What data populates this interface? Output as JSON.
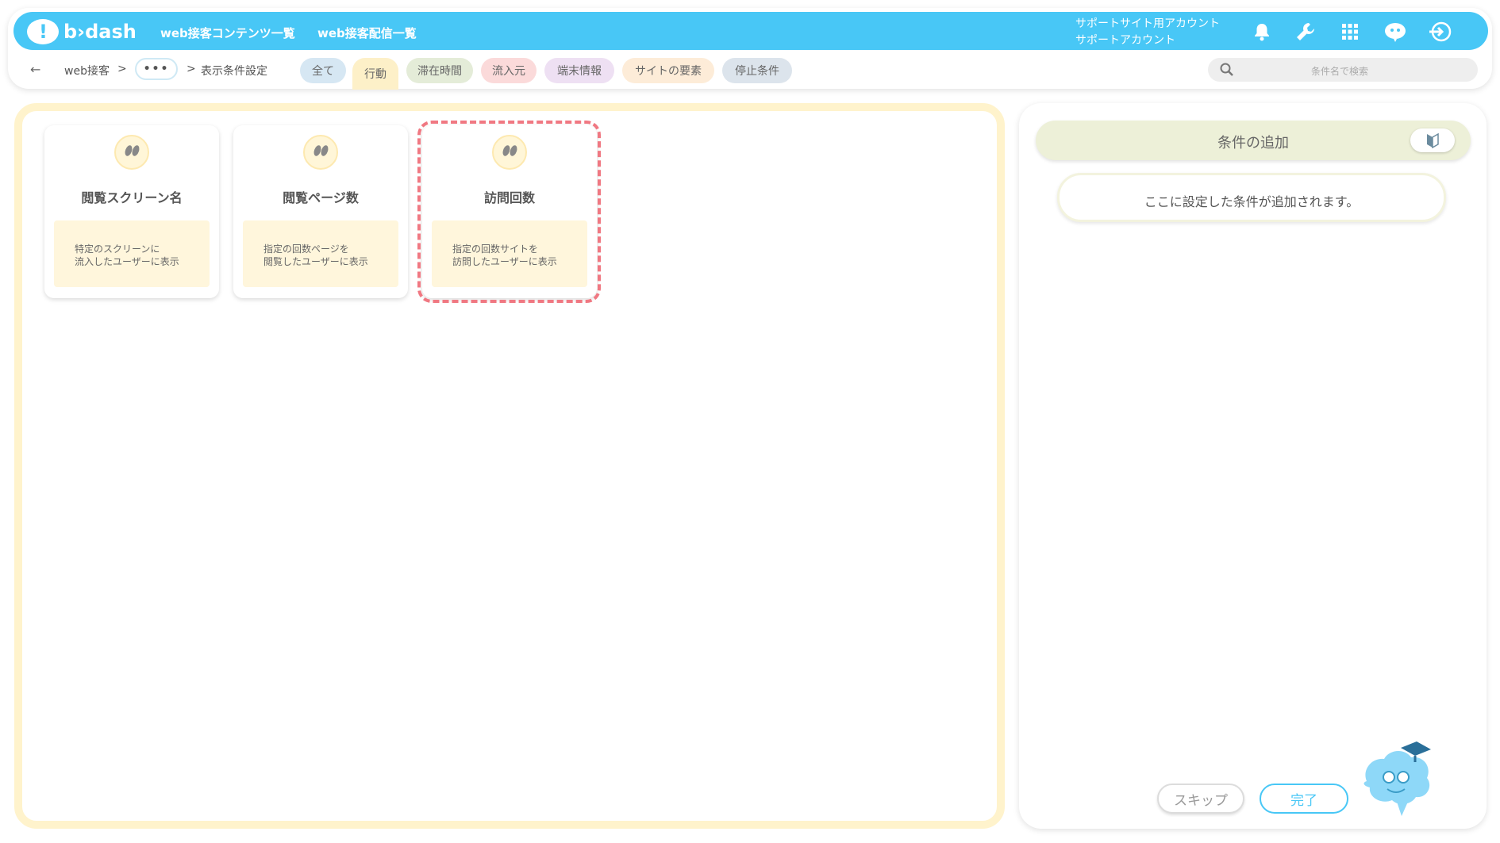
{
  "header": {
    "logo_text": "b›dash",
    "nav": [
      "web接客コンテンツ一覧",
      "web接客配信一覧"
    ],
    "account_line1": "サポートサイト用アカウント",
    "account_line2": "サポートアカウント",
    "icons": [
      "bell-icon",
      "wrench-icon",
      "grid-icon",
      "mascot-chat-icon",
      "logout-icon"
    ]
  },
  "breadcrumb": {
    "back": "←",
    "item1": "web接客",
    "sep": ">",
    "more": "•••",
    "current": "表示条件設定"
  },
  "tabs": [
    {
      "label": "全て",
      "color": "#d6e7f3"
    },
    {
      "label": "行動",
      "color": "#fdf0c8"
    },
    {
      "label": "滞在時間",
      "color": "#e4ecd8"
    },
    {
      "label": "流入元",
      "color": "#fbdada"
    },
    {
      "label": "端末情報",
      "color": "#eee0f3"
    },
    {
      "label": "サイトの要素",
      "color": "#fdecd8"
    },
    {
      "label": "停止条件",
      "color": "#dce4ec"
    }
  ],
  "search": {
    "placeholder": "条件名で検索"
  },
  "cards": [
    {
      "title": "閲覧スクリーン名",
      "desc1": "特定のスクリーンに",
      "desc2": "流入したユーザーに表示"
    },
    {
      "title": "閲覧ページ数",
      "desc1": "指定の回数ページを",
      "desc2": "閲覧したユーザーに表示"
    },
    {
      "title": "訪問回数",
      "desc1": "指定の回数サイトを",
      "desc2": "訪問したユーザーに表示"
    }
  ],
  "right": {
    "add_label": "条件の追加",
    "placeholder": "ここに設定した条件が追加されます。",
    "skip": "スキップ",
    "done": "完了"
  }
}
